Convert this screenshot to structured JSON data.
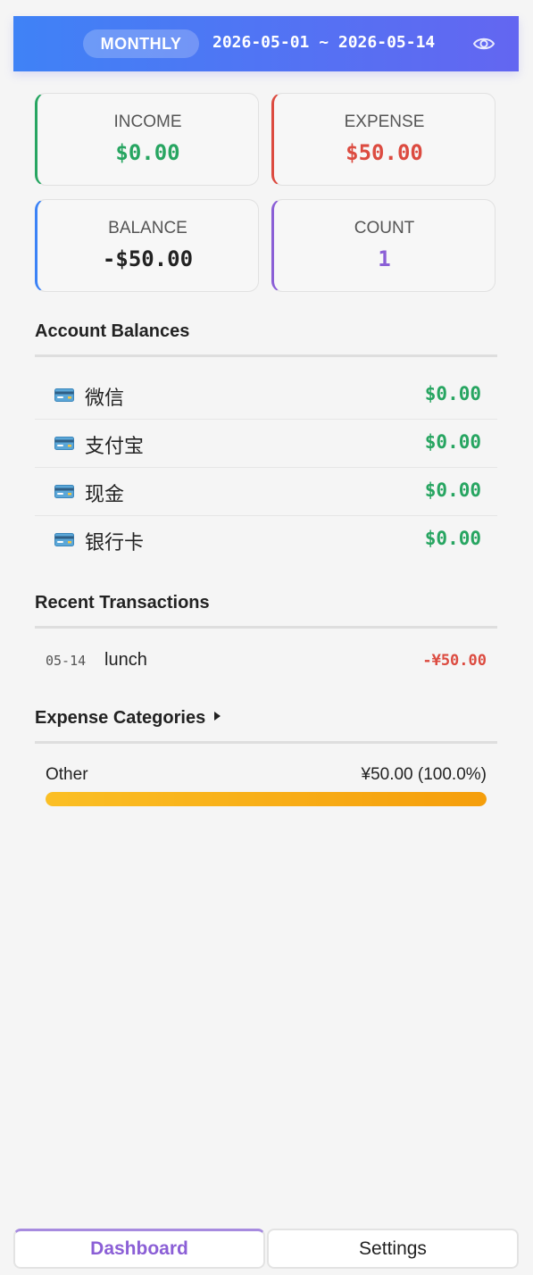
{
  "header": {
    "period": "MONTHLY",
    "date_range": "2026-05-01 ~ 2026-05-14",
    "visibility_icon": "eye-icon",
    "gradient": [
      "#3f82f6",
      "#6366f1"
    ]
  },
  "summary": {
    "income": {
      "label": "INCOME",
      "value": "$0.00",
      "color": "#27a561"
    },
    "expense": {
      "label": "EXPENSE",
      "value": "$50.00",
      "color": "#dc4b40"
    },
    "balance": {
      "label": "BALANCE",
      "value": "-$50.00",
      "color": "#222222"
    },
    "count": {
      "label": "COUNT",
      "value": "1",
      "color": "#8b5fd6"
    }
  },
  "accounts": {
    "title": "Account Balances",
    "items": [
      {
        "icon": "credit-card-icon",
        "name": "微信",
        "balance": "$0.00"
      },
      {
        "icon": "credit-card-icon",
        "name": "支付宝",
        "balance": "$0.00"
      },
      {
        "icon": "credit-card-icon",
        "name": "现金",
        "balance": "$0.00"
      },
      {
        "icon": "credit-card-icon",
        "name": "银行卡",
        "balance": "$0.00"
      }
    ]
  },
  "recent": {
    "title": "Recent Transactions",
    "items": [
      {
        "date": "05-14",
        "description": "lunch",
        "amount": "-¥50.00"
      }
    ]
  },
  "categories": {
    "title": "Expense Categories",
    "toggle_icon": "caret-right-icon",
    "items": [
      {
        "name": "Other",
        "amount_text": "¥50.00 (100.0%)",
        "fraction": 1.0
      }
    ]
  },
  "nav": {
    "dashboard": "Dashboard",
    "settings": "Settings",
    "active": "Dashboard",
    "active_color": "#8b5fd6"
  }
}
